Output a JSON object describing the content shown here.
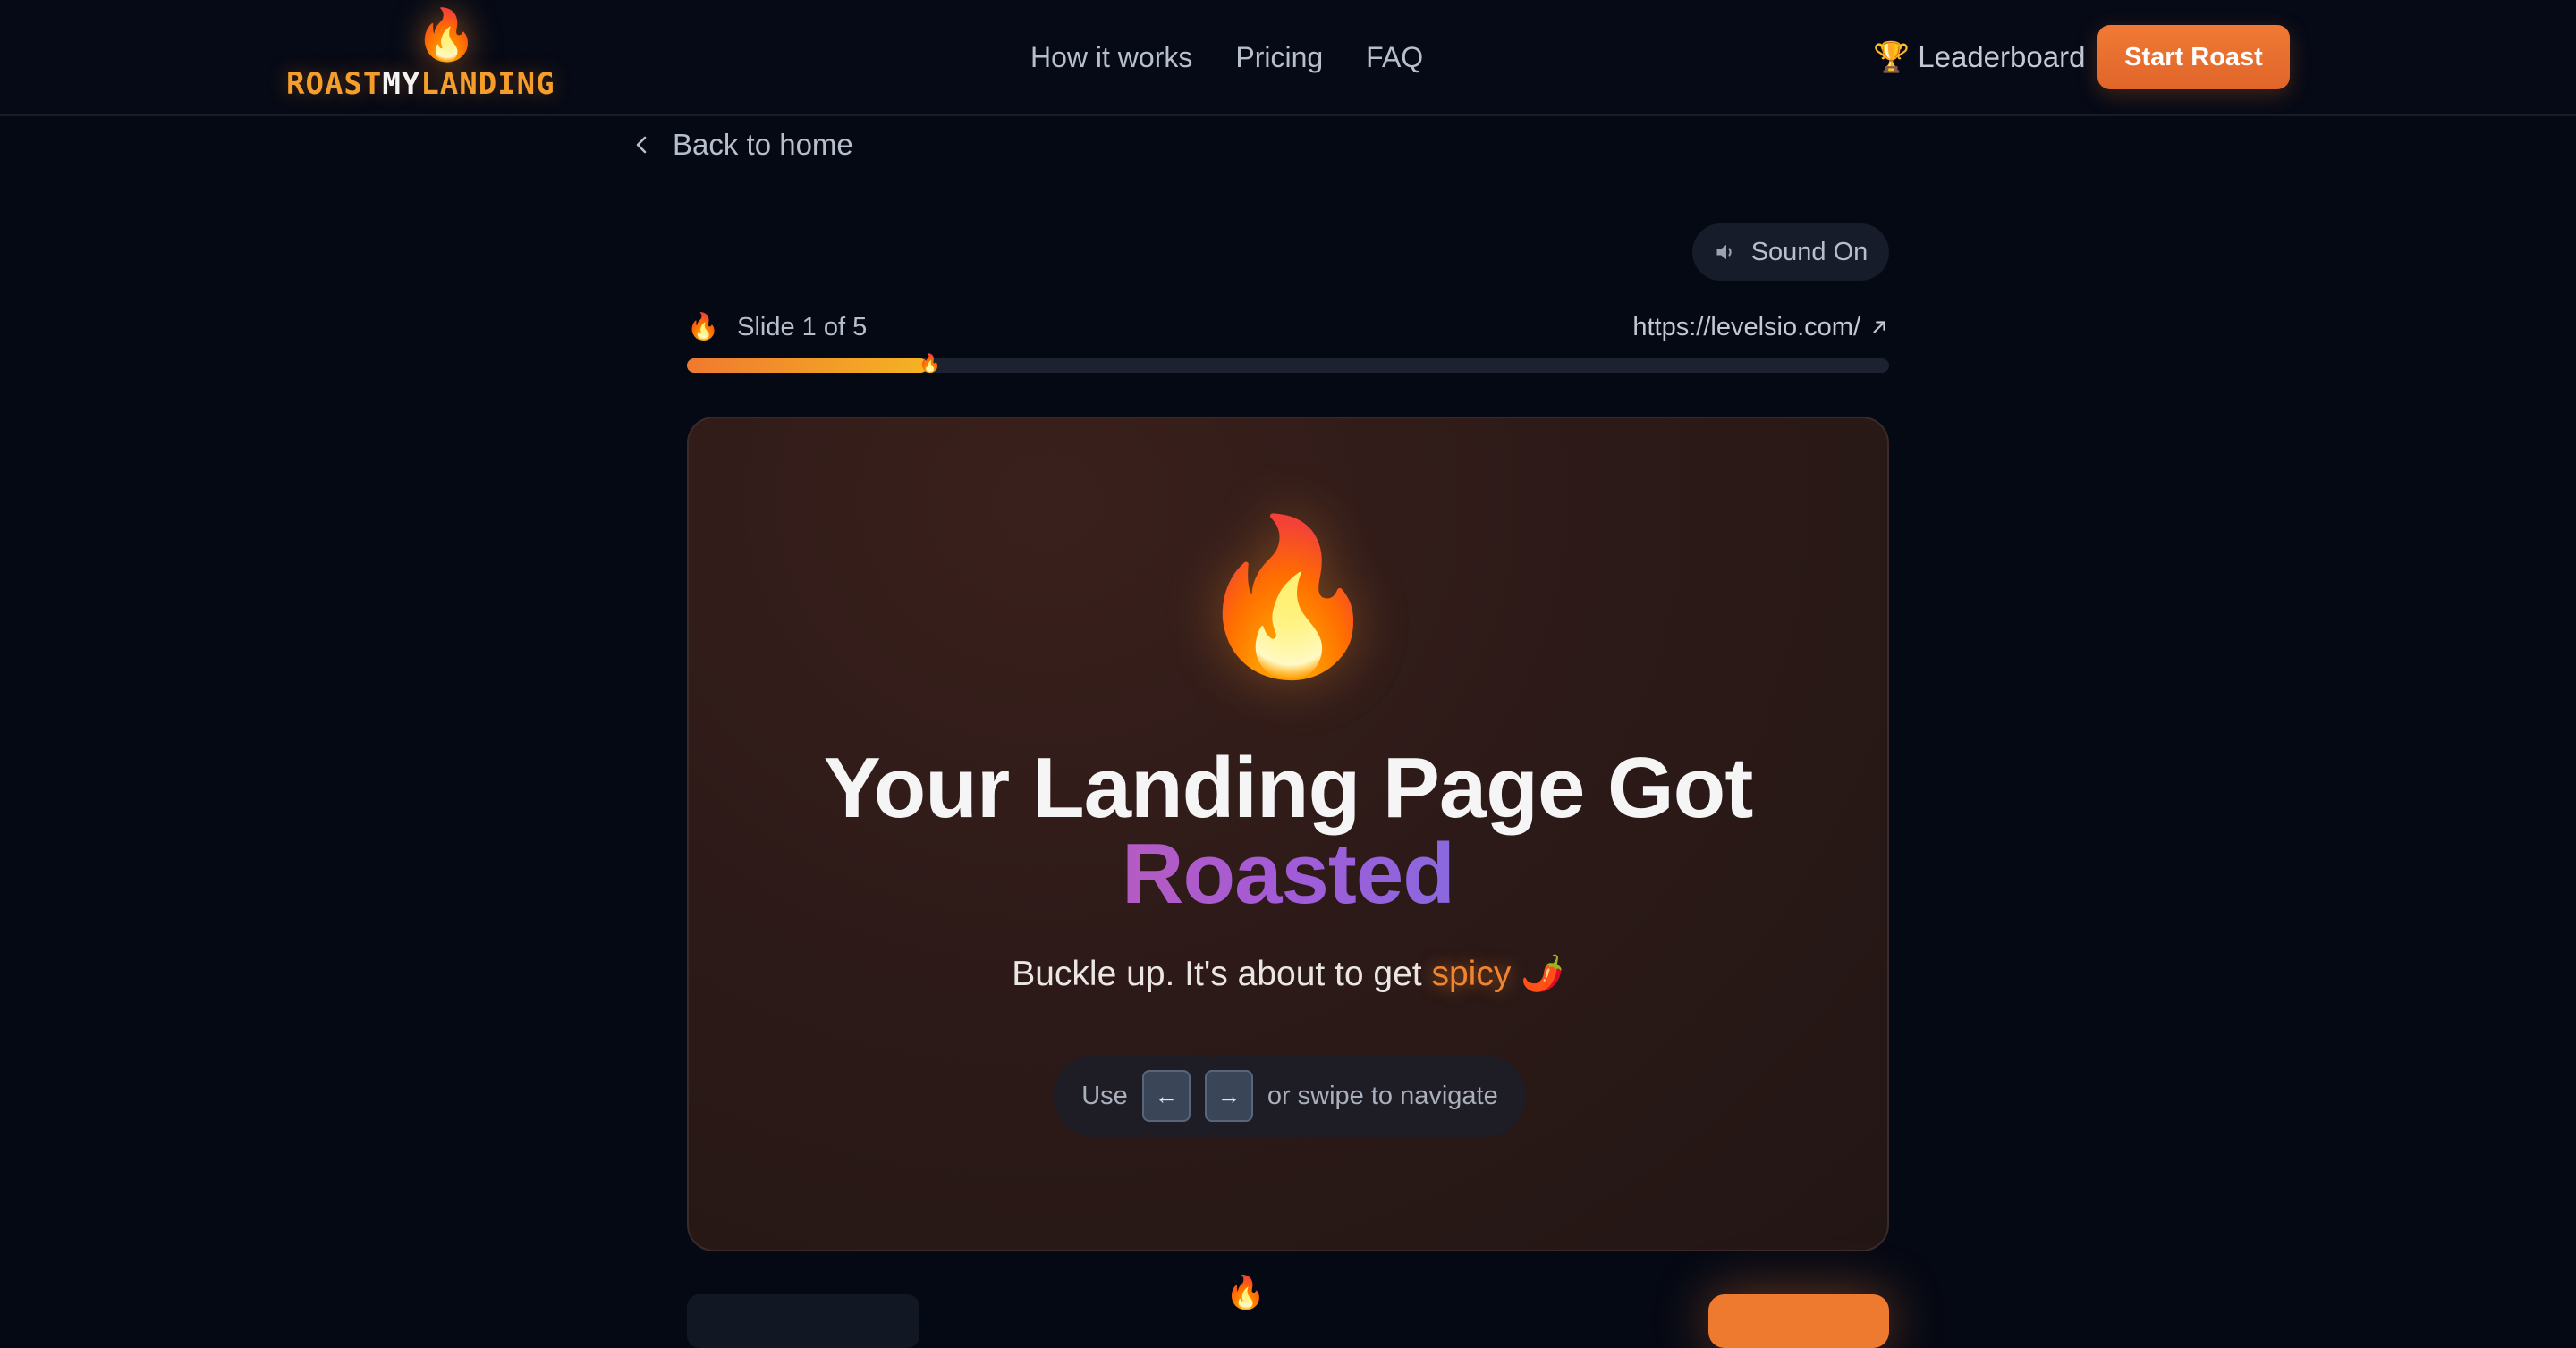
{
  "header": {
    "logo": {
      "icon": "fire-icon",
      "part1": "ROAST",
      "part2": "MY",
      "part3": "LANDING"
    },
    "nav": [
      {
        "label": "How it works"
      },
      {
        "label": "Pricing"
      },
      {
        "label": "FAQ"
      }
    ],
    "leaderboard": {
      "icon": "🏆",
      "label": "Leaderboard"
    },
    "start_button": "Start Roast"
  },
  "back_link": {
    "label": "Back to home"
  },
  "sound_toggle": {
    "icon": "speaker-icon",
    "label": "Sound On"
  },
  "progress": {
    "icon": "🔥",
    "slide_label": "Slide 1 of 5",
    "url": "https://levelsio.com/",
    "current": 1,
    "total": 5,
    "fraction": 0.2
  },
  "slide": {
    "emoji": "🔥",
    "title_line1": "Your Landing Page Got",
    "title_line2": "Roasted",
    "subtitle_pre": "Buckle up. It's about to get ",
    "subtitle_highlight": "spicy",
    "subtitle_emoji": "🌶️",
    "hint_pre": "Use",
    "key_prev": "←",
    "key_next": "→",
    "hint_post": "or swipe to navigate"
  },
  "footer": {
    "flame": "🔥"
  },
  "colors": {
    "background": "#050914",
    "accent": "#ee7a30",
    "logo_orange": "#f59e2b",
    "spicy": "#f1842f"
  }
}
